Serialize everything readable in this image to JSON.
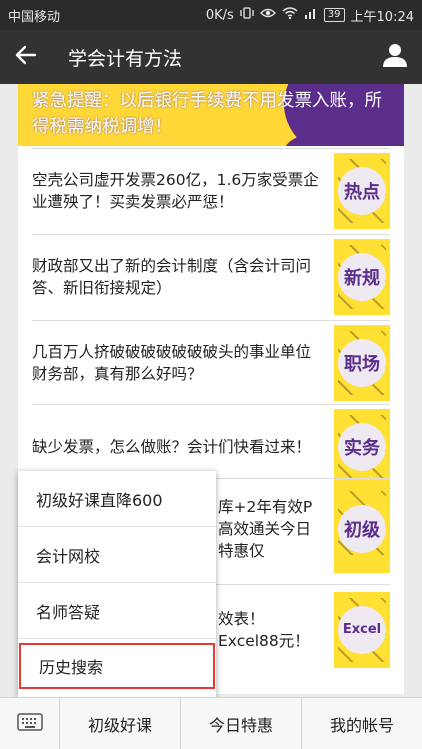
{
  "status_bar": {
    "carrier": "中国移动",
    "speed": "0K/s",
    "signal_label": "4G",
    "battery": "39",
    "time": "上午10:24"
  },
  "header": {
    "title": "学会计有方法",
    "back_icon": "arrow-left-icon",
    "profile_icon": "person-icon"
  },
  "banner": {
    "text": "紧急提醒：以后银行手续费不用发票入账，所得税需纳税调增！",
    "colors": {
      "yellow": "#ffd838",
      "purple": "#5a2e8a"
    }
  },
  "articles": [
    {
      "title": "空壳公司虚开发票260亿，1.6万家受票企业遭殃了！买卖发票必严惩！",
      "tag": "热点"
    },
    {
      "title": "财政部又出了新的会计制度（含会计司问答、新旧衔接规定）",
      "tag": "新规"
    },
    {
      "title": "几百万人挤破破破破破破破头的事业单位财务部，真有那么好吗？",
      "tag": "职场"
    },
    {
      "title": "缺少发票，怎么做账？会计们快看过来！",
      "tag": "实务"
    },
    {
      "title": "库+2年有效P高效通关今日特惠仅",
      "tag": "初级"
    },
    {
      "title": "效表！Excel88元！",
      "tag": "Excel"
    }
  ],
  "popup_menu": {
    "items": [
      {
        "label": "初级好课直降600"
      },
      {
        "label": "会计网校"
      },
      {
        "label": "名师答疑"
      },
      {
        "label": "历史搜索"
      }
    ],
    "highlight_color": "#e53935"
  },
  "bottom_menu": {
    "keyboard_icon": "keyboard-icon",
    "tabs": [
      {
        "label": "初级好课"
      },
      {
        "label": "今日特惠"
      },
      {
        "label": "我的帐号"
      }
    ]
  }
}
